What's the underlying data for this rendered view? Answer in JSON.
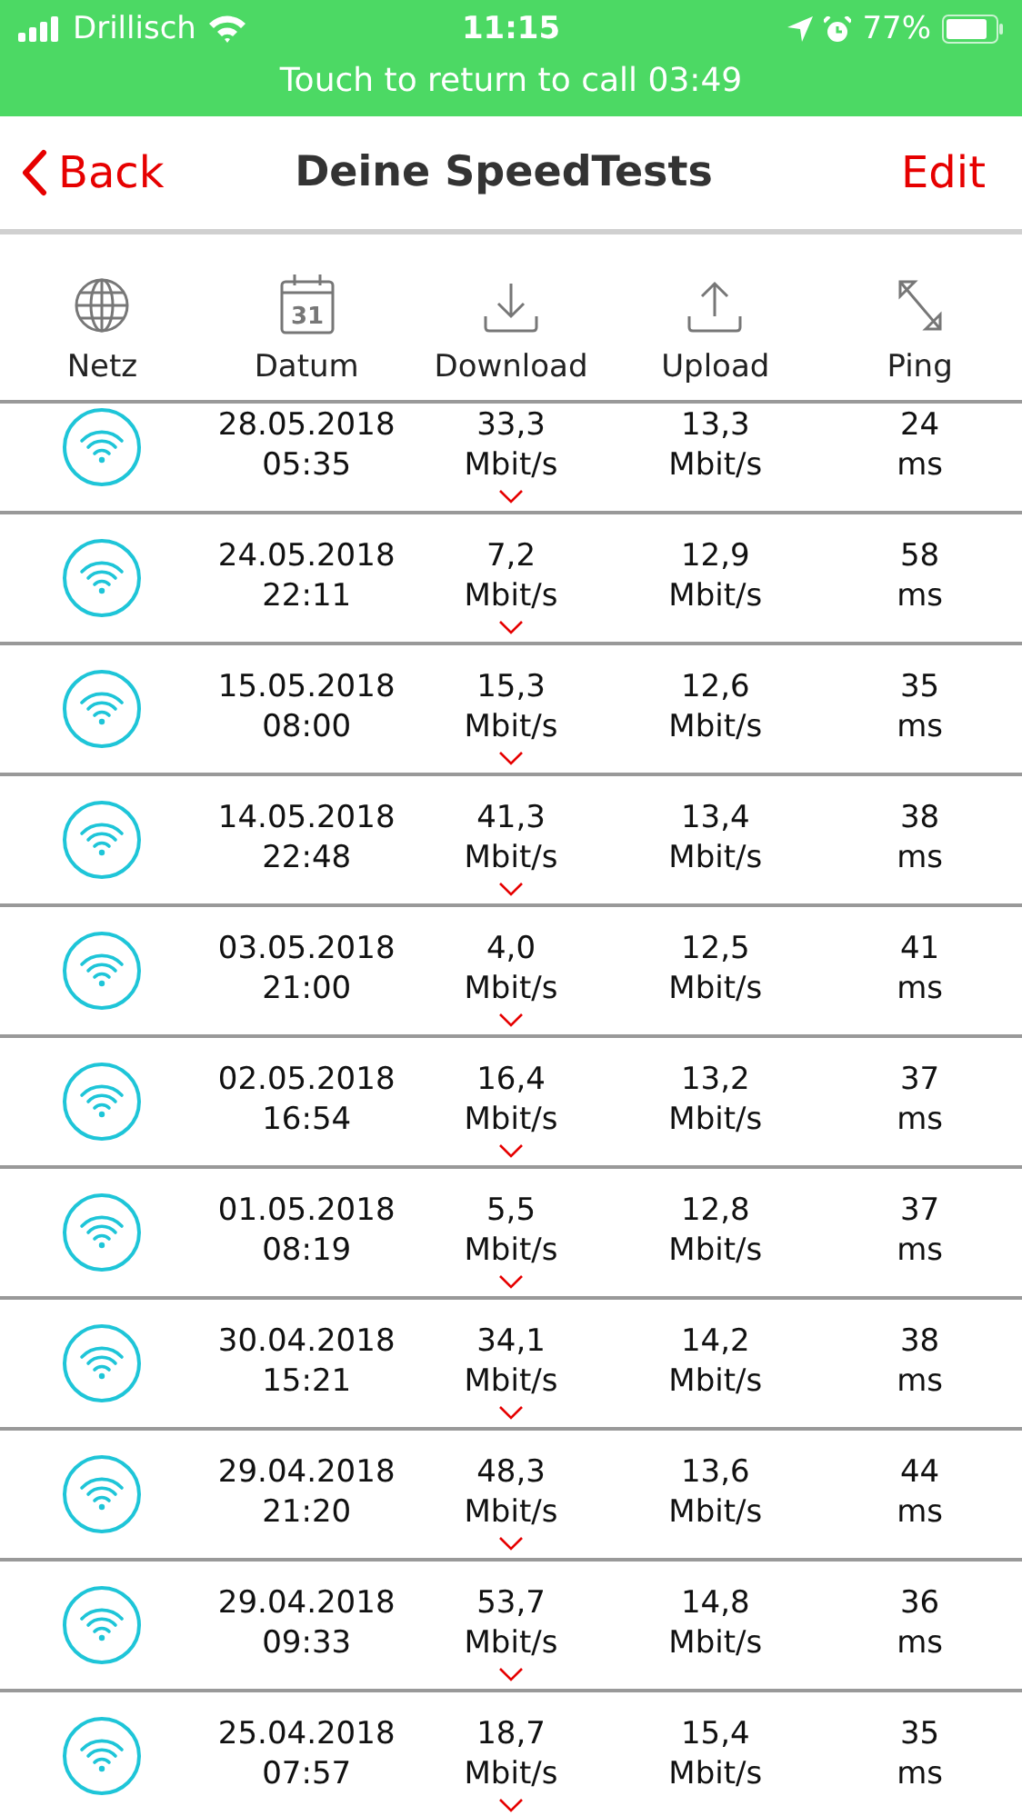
{
  "status_bar": {
    "carrier": "Drillisch",
    "time": "11:15",
    "battery": "77%"
  },
  "call_banner": "Touch to return to call 03:49",
  "nav": {
    "back": "Back",
    "title": "Deine SpeedTests",
    "edit": "Edit"
  },
  "columns": [
    {
      "label": "Netz",
      "kind": "globe"
    },
    {
      "label": "Datum",
      "kind": "calendar",
      "icon_text": "31"
    },
    {
      "label": "Download",
      "kind": "download"
    },
    {
      "label": "Upload",
      "kind": "upload"
    },
    {
      "label": "Ping",
      "kind": "ping"
    }
  ],
  "rows": [
    {
      "date": "28.05.2018",
      "time": "05:35",
      "download": "33,3",
      "download_unit": "Mbit/s",
      "upload": "13,3",
      "upload_unit": "Mbit/s",
      "ping": "24",
      "ping_unit": "ms"
    },
    {
      "date": "24.05.2018",
      "time": "22:11",
      "download": "7,2",
      "download_unit": "Mbit/s",
      "upload": "12,9",
      "upload_unit": "Mbit/s",
      "ping": "58",
      "ping_unit": "ms"
    },
    {
      "date": "15.05.2018",
      "time": "08:00",
      "download": "15,3",
      "download_unit": "Mbit/s",
      "upload": "12,6",
      "upload_unit": "Mbit/s",
      "ping": "35",
      "ping_unit": "ms"
    },
    {
      "date": "14.05.2018",
      "time": "22:48",
      "download": "41,3",
      "download_unit": "Mbit/s",
      "upload": "13,4",
      "upload_unit": "Mbit/s",
      "ping": "38",
      "ping_unit": "ms"
    },
    {
      "date": "03.05.2018",
      "time": "21:00",
      "download": "4,0",
      "download_unit": "Mbit/s",
      "upload": "12,5",
      "upload_unit": "Mbit/s",
      "ping": "41",
      "ping_unit": "ms"
    },
    {
      "date": "02.05.2018",
      "time": "16:54",
      "download": "16,4",
      "download_unit": "Mbit/s",
      "upload": "13,2",
      "upload_unit": "Mbit/s",
      "ping": "37",
      "ping_unit": "ms"
    },
    {
      "date": "01.05.2018",
      "time": "08:19",
      "download": "5,5",
      "download_unit": "Mbit/s",
      "upload": "12,8",
      "upload_unit": "Mbit/s",
      "ping": "37",
      "ping_unit": "ms"
    },
    {
      "date": "30.04.2018",
      "time": "15:21",
      "download": "34,1",
      "download_unit": "Mbit/s",
      "upload": "14,2",
      "upload_unit": "Mbit/s",
      "ping": "38",
      "ping_unit": "ms"
    },
    {
      "date": "29.04.2018",
      "time": "21:20",
      "download": "48,3",
      "download_unit": "Mbit/s",
      "upload": "13,6",
      "upload_unit": "Mbit/s",
      "ping": "44",
      "ping_unit": "ms"
    },
    {
      "date": "29.04.2018",
      "time": "09:33",
      "download": "53,7",
      "download_unit": "Mbit/s",
      "upload": "14,8",
      "upload_unit": "Mbit/s",
      "ping": "36",
      "ping_unit": "ms"
    },
    {
      "date": "25.04.2018",
      "time": "07:57",
      "download": "18,7",
      "download_unit": "Mbit/s",
      "upload": "15,4",
      "upload_unit": "Mbit/s",
      "ping": "35",
      "ping_unit": "ms"
    }
  ]
}
